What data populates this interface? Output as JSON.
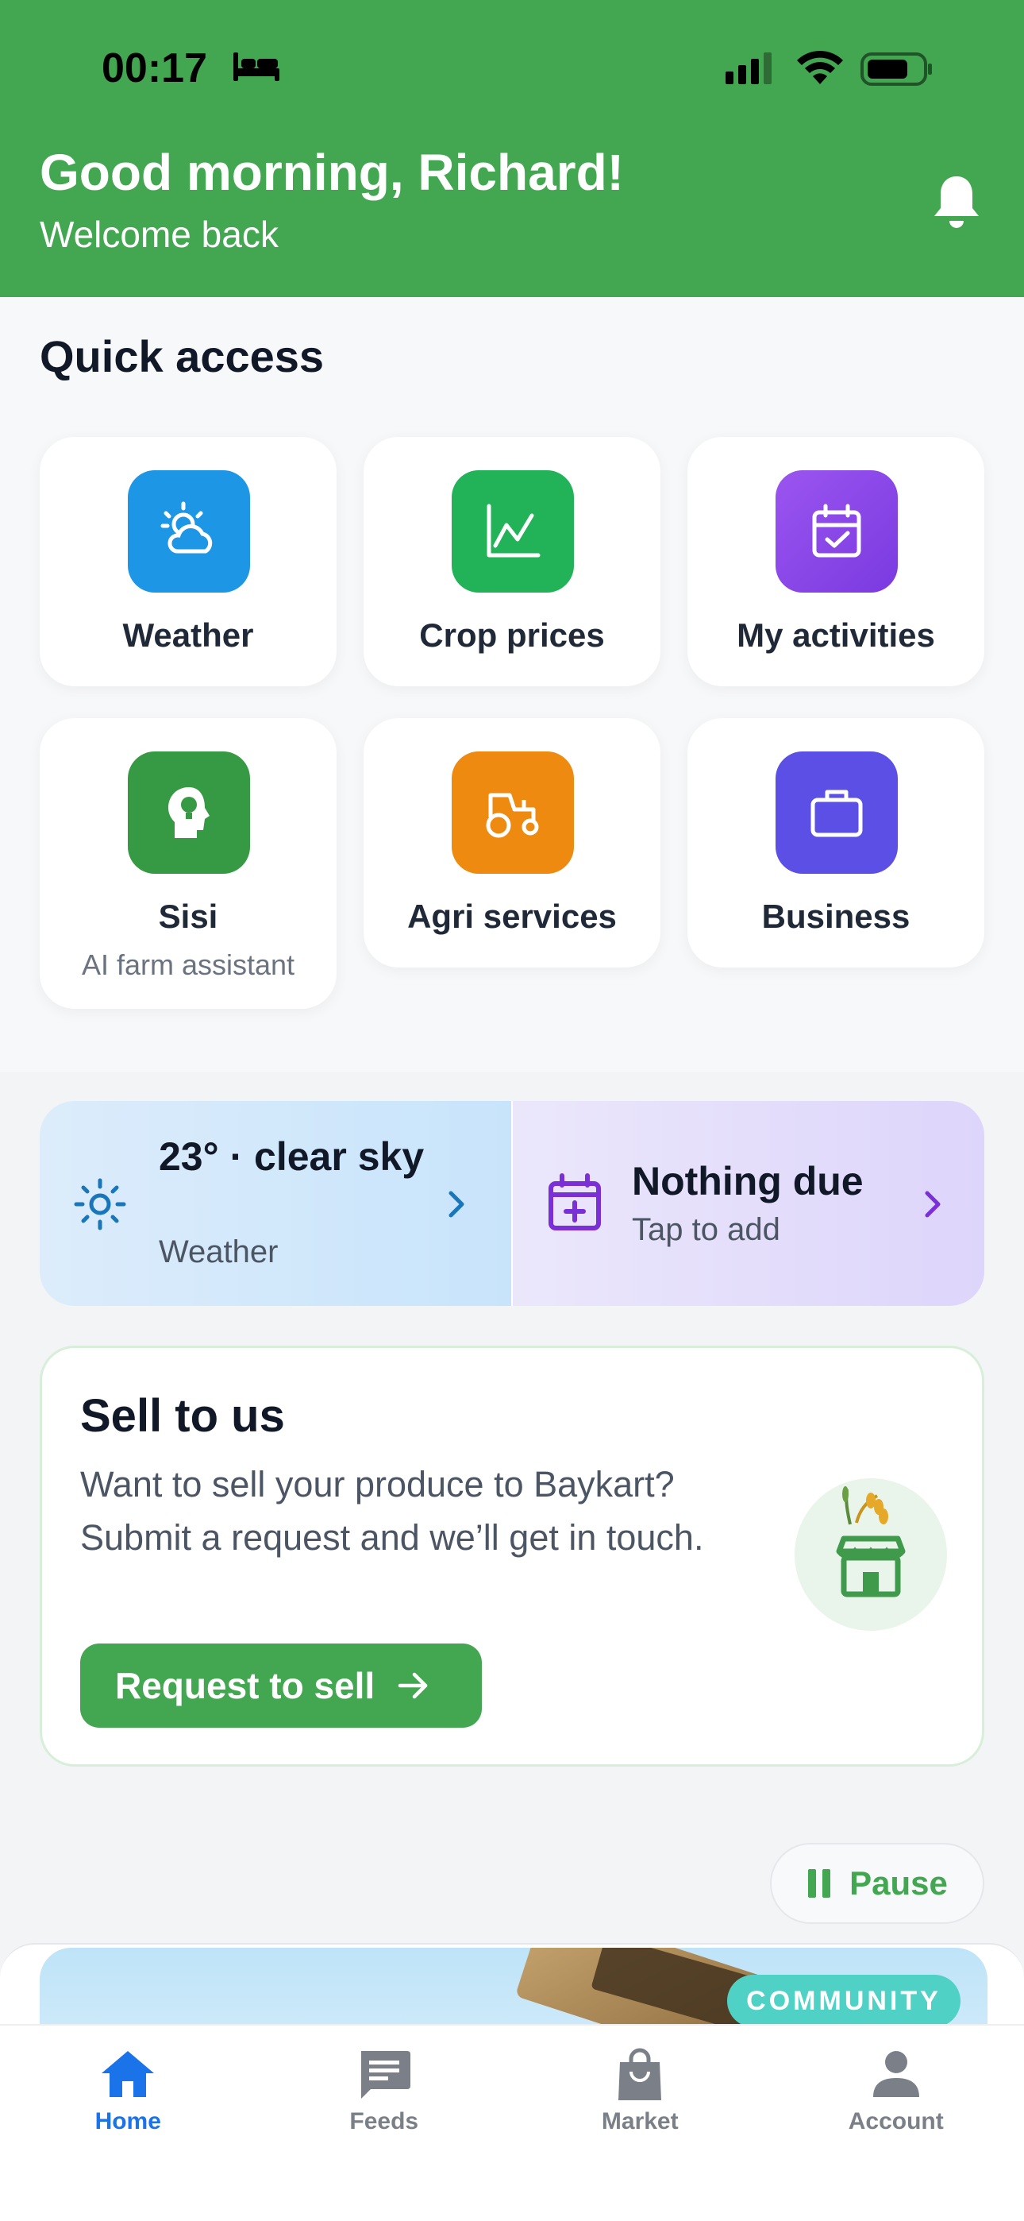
{
  "status_bar": {
    "time": "00:17",
    "icons": [
      "bed-icon",
      "signal-icon",
      "wifi-icon",
      "battery-icon"
    ]
  },
  "header": {
    "greeting": "Good morning, Richard!",
    "subtitle": "Welcome back",
    "icon": "bell-icon",
    "bg_color": "#43a651"
  },
  "quick_access": {
    "title": "Quick access",
    "tiles": [
      {
        "label": "Weather",
        "icon": "weather-icon",
        "color": "#1e96e6"
      },
      {
        "label": "Crop prices",
        "icon": "chart-icon",
        "color": "#22b358"
      },
      {
        "label": "My activities",
        "icon": "calendar-check-icon",
        "color": "#8b46e6"
      },
      {
        "label": "Sisi",
        "sublabel": "AI farm assistant",
        "icon": "bulb-head-icon",
        "color": "#369a45"
      },
      {
        "label": "Agri services",
        "icon": "tractor-icon",
        "color": "#ee8a10"
      },
      {
        "label": "Business",
        "icon": "briefcase-icon",
        "color": "#5b4fe6"
      }
    ]
  },
  "weather_card": {
    "temperature_text": "23° · clear sky",
    "caption": "Weather"
  },
  "activity_card": {
    "title": "Nothing due",
    "caption": "Tap to add"
  },
  "sell_card": {
    "title": "Sell to us",
    "description": "Want to sell your produce to Baykart? Submit a request and we’ll get in touch.",
    "button_label": "Request to sell"
  },
  "carousel": {
    "pause_label": "Pause",
    "badge": "COMMUNITY"
  },
  "bottom_nav": {
    "items": [
      {
        "label": "Home",
        "icon": "home-icon",
        "active": true
      },
      {
        "label": "Feeds",
        "icon": "chat-icon",
        "active": false
      },
      {
        "label": "Market",
        "icon": "shopping-bag-icon",
        "active": false
      },
      {
        "label": "Account",
        "icon": "person-icon",
        "active": false
      }
    ],
    "active_color": "#1a73e8"
  }
}
